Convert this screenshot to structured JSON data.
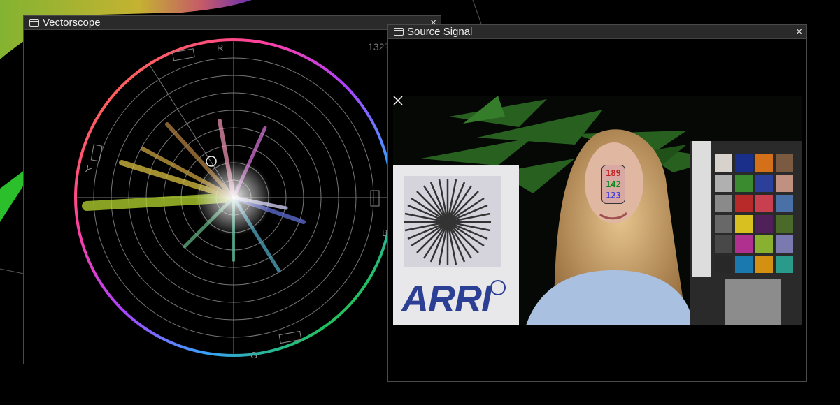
{
  "vectorscope": {
    "title": "Vectorscope",
    "close_label": "×",
    "readout": "132%",
    "targets": {
      "r": "R",
      "b": "B",
      "g": "G",
      "y": "Y"
    }
  },
  "source": {
    "title": "Source Signal",
    "close_label": "×",
    "picker": {
      "r": "189",
      "g": "142",
      "b": "123"
    },
    "chart_logo": "ARRI"
  },
  "colors": {
    "titlebar": "#2a2a2a",
    "panel_border": "#4a4a4a",
    "picker_bg": "#d8a8a2"
  }
}
